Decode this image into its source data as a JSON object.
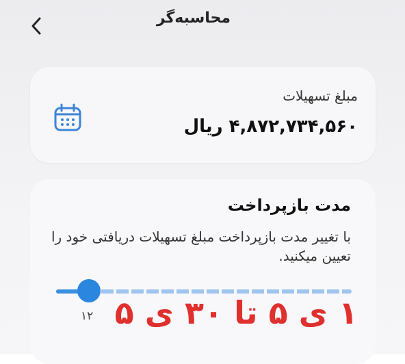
{
  "header": {
    "title": "محاسبه‌گر",
    "back_icon": "chevron-left-icon"
  },
  "facility_amount": {
    "label": "مبلغ تسهیلات",
    "value": "۴,۸۷۲,۷۳۴,۵۶۰ ریال",
    "icon": "calendar-icon",
    "icon_color": "#3b86d6"
  },
  "repayment_duration": {
    "title": "مدت بازپرداخت",
    "description": "با تغییر مدت بازپرداخت مبلغ تسهیلات دریافتی خود را تعیین میکنید.",
    "slider": {
      "min_label": "۱۲",
      "level": 0.11,
      "accent_color": "#2b86e0"
    },
    "range_annotation": "۱ ی ۵ تا ۳۰ ی ۵",
    "annotation_color": "#e0302e"
  }
}
